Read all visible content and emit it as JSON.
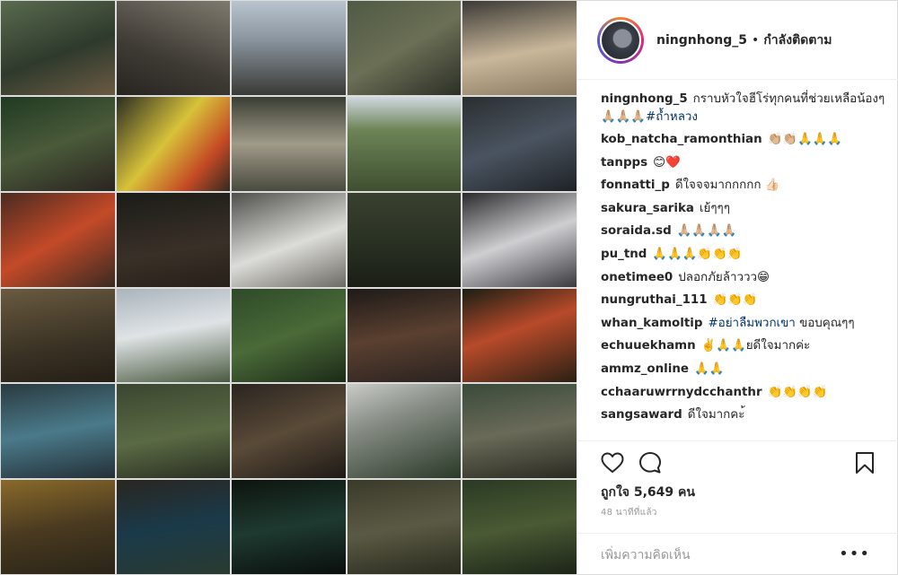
{
  "header": {
    "username": "ningnhong_5",
    "dot": "•",
    "follow_status": "กำลังติดตาม"
  },
  "caption": {
    "username": "ningnhong_5",
    "text": "กราบหัวใจฮีโร่ทุกคนที่ช่วยเหลือน้องๆ 🙏🏼🙏🏼🙏🏼",
    "hashtag": "#ถ้ำหลวง"
  },
  "comments": [
    {
      "username": "kob_natcha_ramonthian",
      "text": "👏🏼👏🏼🙏🙏🙏"
    },
    {
      "username": "tanpps",
      "text": "😊❤️"
    },
    {
      "username": "fonnatti_p",
      "text": "ดีใจจจมากกกกก 👍🏻"
    },
    {
      "username": "sakura_sarika",
      "text": "เย้ๆๆๆ"
    },
    {
      "username": "soraida.sd",
      "text": "🙏🏼🙏🏼🙏🏼🙏🏼"
    },
    {
      "username": "pu_tnd",
      "text": "🙏🙏🙏👏👏👏"
    },
    {
      "username": "onetimee0",
      "text": "ปลอกภัยล้าววว😁"
    },
    {
      "username": "nungruthai_111",
      "text": "👏👏👏"
    },
    {
      "username": "whan_kamoltip",
      "hashtag": "#อย่าลืมพวกเขา",
      "text": "ขอบคุณๆๆ"
    },
    {
      "username": "echuuekhamn",
      "text": "✌️🙏🙏ยดีใจมากค่ะ"
    },
    {
      "username": "ammz_online",
      "text": "🙏🙏"
    },
    {
      "username": "cchaaruwrrnydcchanthr",
      "text": "👏👏👏👏"
    },
    {
      "username": "sangsaward",
      "text": "ดีใจมากคะ้"
    }
  ],
  "actions": {
    "likes": "ถูกใจ 5,649 คน",
    "time": "48 นาทีที่แล้ว",
    "comment_placeholder": "เพิ่มความคิดเห็น",
    "more": "•••"
  },
  "icons": {
    "like": "heart-icon",
    "comment": "comment-icon",
    "save": "bookmark-icon",
    "more": "more-options-icon"
  },
  "colors": {
    "text": "#262626",
    "secondary": "#999999",
    "hashtag": "#003569",
    "border": "#efefef"
  }
}
